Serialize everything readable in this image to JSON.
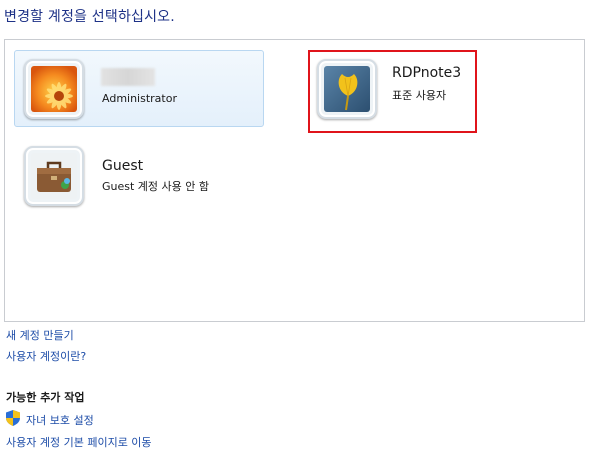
{
  "heading": "변경할 계정을 선택하십시오.",
  "accounts": [
    {
      "name": "",
      "type": "Administrator",
      "icon": "orange-flower-icon",
      "selected": true
    },
    {
      "name": "RDPnote3",
      "type": "표준 사용자",
      "icon": "ginkgo-leaf-icon",
      "highlighted": true
    },
    {
      "name": "Guest",
      "type": "Guest 계정 사용 안 함",
      "icon": "briefcase-icon"
    }
  ],
  "links": {
    "create_account": "새 계정 만들기",
    "what_is_account": "사용자 계정이란?"
  },
  "additional": {
    "title": "가능한 추가 작업",
    "parental_controls": "자녀 보호 설정",
    "go_main_page": "사용자 계정 기본 페이지로 이동"
  },
  "colors": {
    "link": "#1e4da8",
    "heading": "#1e3287",
    "highlight": "#e0141b"
  }
}
